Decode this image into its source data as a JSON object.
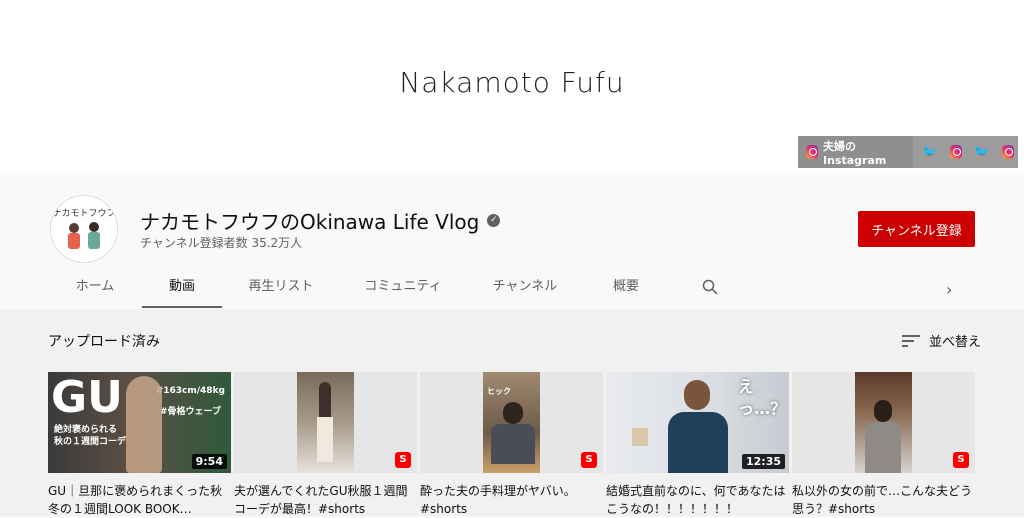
{
  "banner": {
    "title": "Nakamoto Fufu",
    "links": [
      {
        "label": "夫婦のInstagram",
        "icon": "instagram-icon"
      },
      {
        "icon": "twitter-icon"
      },
      {
        "icon": "instagram-icon"
      },
      {
        "icon": "twitter-icon"
      },
      {
        "icon": "instagram-icon"
      }
    ]
  },
  "channel": {
    "avatar_text": "ナカモトフウフ",
    "name": "ナカモトフウフのOkinawa Life Vlog",
    "verified_icon": "verified-check-icon",
    "subscribers": "チャンネル登録者数 35.2万人",
    "subscribe_label": "チャンネル登録"
  },
  "tabs": [
    {
      "label": "ホーム"
    },
    {
      "label": "動画",
      "active": true
    },
    {
      "label": "再生リスト"
    },
    {
      "label": "コミュニティ"
    },
    {
      "label": "チャンネル"
    },
    {
      "label": "概要"
    }
  ],
  "section": {
    "title": "アップロード済み",
    "sort_label": "並べ替え"
  },
  "videos": [
    {
      "title": "GU｜旦那に褒められまくった秋冬の１週間LOOK BOOK…",
      "duration": "9:54",
      "thumb_text_main": "GU",
      "thumb_text_sub": "#163cm/48kg",
      "thumb_text_sub2": "#骨格ウェーブ",
      "thumb_caption1": "絶対褒められる",
      "thumb_caption2": "秋の１週間コーデ"
    },
    {
      "title": "夫が選んでくれたGU秋服１週間コーデが最高！#shorts",
      "short": true
    },
    {
      "title": "酔った夫の手料理がヤバい。#shorts",
      "short": true,
      "thumb_text": "ヒック"
    },
    {
      "title": "結婚式直前なのに、何であなたはこうなの！！！！！！！",
      "duration": "12:35",
      "thumb_text": "えっ…？"
    },
    {
      "title": "私以外の女の前で…こんな夫どう思う？#shorts",
      "short": true
    }
  ],
  "colors": {
    "subscribe": "#cc0000",
    "shorts": "#ff0000",
    "twitter": "#1da1f2"
  }
}
